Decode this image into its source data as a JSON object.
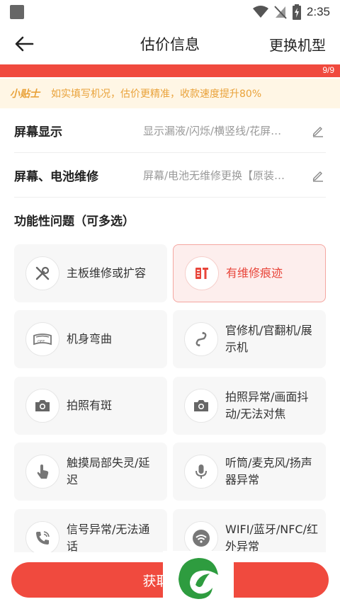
{
  "status_bar": {
    "time": "2:35"
  },
  "header": {
    "title": "估价信息",
    "change_model": "更换机型"
  },
  "progress": {
    "text": "9/9",
    "value": 1.0,
    "color": "#f04a3e"
  },
  "tip": {
    "label": "小贴士",
    "text": "如实填写机况，估价更精准，收款速度提升80%"
  },
  "rows": [
    {
      "label": "屏幕显示",
      "value": "显示漏液/闪烁/横竖线/花屏…"
    },
    {
      "label": "屏幕、电池维修",
      "value": "屏幕/电池无维修更换【原装…"
    }
  ],
  "functional": {
    "title": "功能性问题（可多选）",
    "options": [
      {
        "label": "主板维修或扩容",
        "icon": "wrench-screwdriver-icon",
        "selected": false
      },
      {
        "label": "有维修痕迹",
        "icon": "repair-trace-icon",
        "selected": true
      },
      {
        "label": "机身弯曲",
        "icon": "bent-phone-icon",
        "selected": false
      },
      {
        "label": "官修机/官翻机/展示机",
        "icon": "link-icon",
        "selected": false
      },
      {
        "label": "拍照有斑",
        "icon": "camera-icon",
        "selected": false
      },
      {
        "label": "拍照异常/画面抖动/无法对焦",
        "icon": "camera-icon",
        "selected": false
      },
      {
        "label": "触摸局部失灵/延迟",
        "icon": "touch-hand-icon",
        "selected": false
      },
      {
        "label": "听筒/麦克风/扬声器异常",
        "icon": "microphone-icon",
        "selected": false
      },
      {
        "label": "信号异常/无法通话",
        "icon": "phone-call-icon",
        "selected": false
      },
      {
        "label": "WIFI/蓝牙/NFC/红外异常",
        "icon": "wifi-icon",
        "selected": false
      }
    ]
  },
  "bottom_button": {
    "label": "获取精"
  },
  "colors": {
    "accent": "#f04a3e",
    "tip_text": "#e9a23a",
    "tip_bg": "#fff6e5",
    "logo_green": "#2e9c3f"
  }
}
